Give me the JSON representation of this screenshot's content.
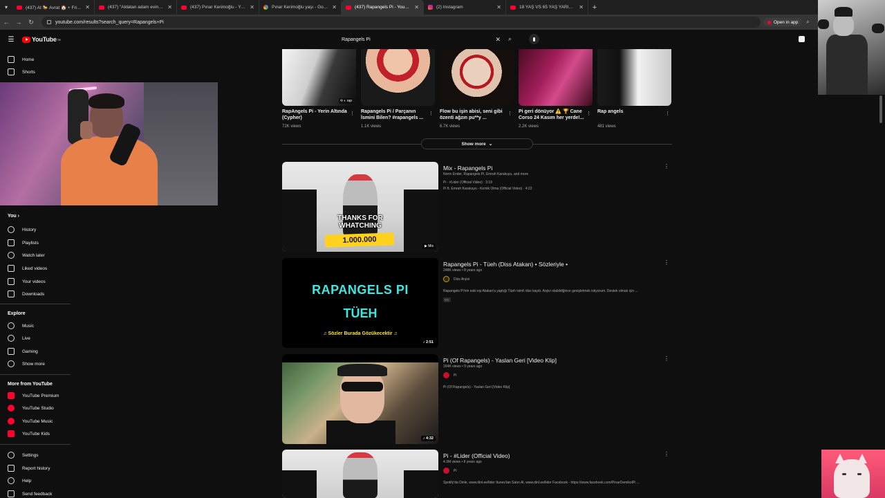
{
  "browser": {
    "tabs": [
      {
        "title": "(437) At 🐎 Avrat 🏠 + Friend 🧔",
        "icon": "youtube"
      },
      {
        "title": "(437) \"Aldatan adam evine dah",
        "icon": "youtube"
      },
      {
        "title": "(437) Pınar Kerimoğlu - YouTub",
        "icon": "youtube"
      },
      {
        "title": "Pınar Kerimoğlu yaşı - Google'd",
        "icon": "google"
      },
      {
        "title": "(437) Rapangels Pi - YouTube",
        "icon": "youtube",
        "active": true
      },
      {
        "title": "(2) Instagram",
        "icon": "instagram"
      },
      {
        "title": "18 YAŞ VS 65 YAŞ YARIŞIYOR! i",
        "icon": "youtube"
      }
    ],
    "url": "youtube.com/results?search_query=Rapangels+Pi",
    "open_in_app": "Open in app"
  },
  "masthead": {
    "logo_text": "YouTube",
    "logo_sup": "TR",
    "search_value": "Rapangels Pi"
  },
  "sidebar": {
    "main": [
      {
        "label": "Home",
        "icon": "home-icon"
      },
      {
        "label": "Shorts",
        "icon": "shorts-icon"
      }
    ],
    "you_heading": "You",
    "you_items": [
      {
        "label": "History",
        "icon": "history-icon"
      },
      {
        "label": "Playlists",
        "icon": "playlists-icon"
      },
      {
        "label": "Watch later",
        "icon": "clock-icon"
      },
      {
        "label": "Liked videos",
        "icon": "thumb-up-icon"
      },
      {
        "label": "Your videos",
        "icon": "video-icon"
      },
      {
        "label": "Downloads",
        "icon": "download-icon"
      }
    ],
    "explore_heading": "Explore",
    "explore_items": [
      {
        "label": "Music",
        "icon": "music-icon"
      },
      {
        "label": "Live",
        "icon": "live-icon"
      },
      {
        "label": "Gaming",
        "icon": "gaming-icon"
      },
      {
        "label": "Show more",
        "icon": "chevron-down-icon"
      }
    ],
    "more_heading": "More from YouTube",
    "more_items": [
      {
        "label": "YouTube Premium",
        "icon": "youtube-premium-icon"
      },
      {
        "label": "YouTube Studio",
        "icon": "youtube-studio-icon"
      },
      {
        "label": "YouTube Music",
        "icon": "youtube-music-icon"
      },
      {
        "label": "YouTube Kids",
        "icon": "youtube-kids-icon"
      }
    ],
    "footer_items": [
      {
        "label": "Settings",
        "icon": "gear-icon"
      },
      {
        "label": "Report history",
        "icon": "flag-icon"
      },
      {
        "label": "Help",
        "icon": "help-icon"
      },
      {
        "label": "Send feedback",
        "icon": "feedback-icon"
      }
    ]
  },
  "shorts": [
    {
      "title": "RapAngels Pi - Yerin Altında (Cypher)",
      "views": "72K views"
    },
    {
      "title": "Rapangels Pi / Parçanın İsmini Bilen? #rapangels ...",
      "views": "1.1K views"
    },
    {
      "title": "Flow bu işin abisi, seni gibi özenti ağzın pu**y ...",
      "views": "6.7K views"
    },
    {
      "title": "Pi geri dönüyor ⚠️ 🏆 Cane Corso 24 Kasım her yerde!...",
      "views": "2.2K views"
    },
    {
      "title": "Rap angels",
      "views": "481 views"
    }
  ],
  "show_more": "Show more",
  "results": [
    {
      "type": "mix",
      "title": "Mix - Rapangels Pi",
      "meta": "Norm Ender, Rapangels Pi, Emrah Karakuyu, and more",
      "lines": [
        "Pi - #Lider (Official Video) · 3:19",
        "Pi ft. Emrah Karakuyu - Komik Olma (Official Video) · 4:22"
      ],
      "thumb_text_1": "THANKS FOR",
      "thumb_text_2": "WHATCHING",
      "thumb_count": "1.000.000",
      "badge": "Mix"
    },
    {
      "type": "video",
      "title": "Rapangels Pi - Tüeh (Diss Atakan) • Sözleriyle •",
      "meta": "248K views • 8 years ago",
      "channel": "Diss Arşivi",
      "desc": "Rapangels Pi'nin eski eşi Atakan'a yaptığı Tüeh isimli diss kaydı. Arşivi olabildiğince genişletmek istiyorum. Destek olmak için ...",
      "cc": "CC",
      "duration": "2:51",
      "thumb_text_1": "RAPANGELS PI",
      "thumb_text_2": "TÜEH",
      "thumb_sub": "♫ Sözler Burada Gözükecektir ♫"
    },
    {
      "type": "video",
      "title": "Pi (Of Rapangels) - Yaslan Geri [Video Klip]",
      "meta": "164K views • 9 years ago",
      "channel": "Pi",
      "desc": "Pi (Of Rapangels) - Yaslan Geri [Video Klip]",
      "duration": "4:32"
    },
    {
      "type": "video",
      "title": "Pi - #Lider (Official Video)",
      "meta": "4.3M views • 8 years ago",
      "channel": "Pi",
      "desc": "Spotify'da Dinle, www.dinl.ee/lider Itunes'tan Satın Al, www.dinl.ee/lider Facebook - https://www.facebook.com/PinarDemikolPi ..."
    }
  ],
  "colors": {
    "background": "#0f0f0f",
    "accent_red": "#ff0000",
    "text_primary": "#f1f1f1",
    "text_secondary": "#aaaaaa"
  }
}
